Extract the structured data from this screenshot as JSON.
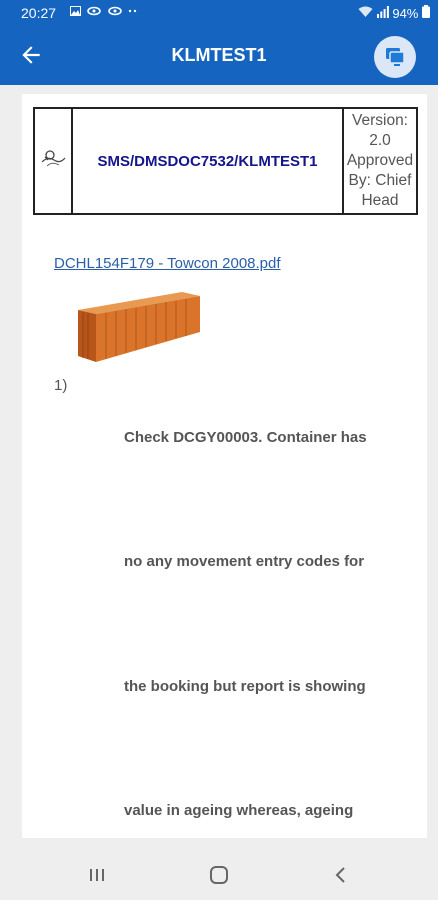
{
  "status_bar": {
    "time": "20:27",
    "battery": "94%",
    "notification_icons": [
      "image-icon",
      "link-icon",
      "link-icon",
      "dots-icon"
    ]
  },
  "app_bar": {
    "title": "KLMTEST1",
    "back_icon": "arrow-left-icon",
    "action_icon": "screen-share-icon"
  },
  "document": {
    "header": {
      "code": "SMS/DMSDOC7532/KLMTEST1",
      "version_lines": [
        "Version:",
        "2.0",
        "Approved",
        "By: Chief",
        "Head"
      ]
    },
    "attachment_link": "DCHL154F179 - Towcon 2008.pdf",
    "list_number": "1)",
    "body_lines": [
      "Check DCGY00003. Container has",
      "no any movement entry codes for",
      "the booking but report is showing",
      "value in ageing whereas, ageing"
    ]
  },
  "colors": {
    "primary": "#1565c0",
    "doc_code": "#14148c",
    "link": "#2b5fa8",
    "container": "#d9742a"
  },
  "nav_bar": {
    "items": [
      "recent-apps-icon",
      "home-icon",
      "back-icon"
    ]
  }
}
